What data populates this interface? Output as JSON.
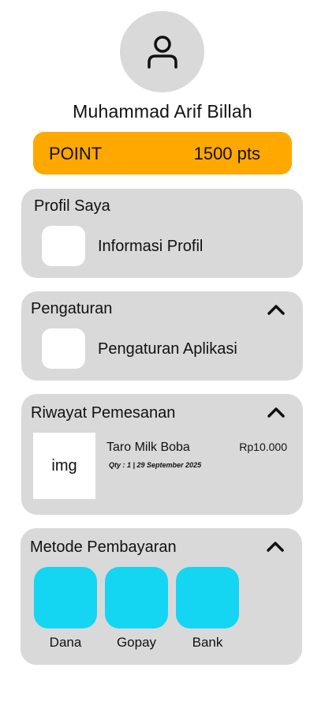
{
  "profile": {
    "name": "Muhammad Arif Billah",
    "avatar_icon": "user-icon"
  },
  "points": {
    "label": "POINT",
    "value": "1500 pts",
    "color": "#ffa800"
  },
  "sections": {
    "profil": {
      "title": "Profil Saya",
      "item": "Informasi Profil"
    },
    "pengaturan": {
      "title": "Pengaturan",
      "item": "Pengaturan Aplikasi",
      "toggle_icon": "chevron-up-icon"
    },
    "riwayat": {
      "title": "Riwayat Pemesanan",
      "toggle_icon": "chevron-up-icon",
      "order": {
        "image_text": "img",
        "name": "Taro Milk Boba",
        "price": "Rp10.000",
        "meta": "Qty : 1 | 29 September 2025"
      }
    },
    "pembayaran": {
      "title": "Metode Pembayaran",
      "toggle_icon": "chevron-up-icon",
      "tile_color": "#15d6f2",
      "methods": [
        "Dana",
        "Gopay",
        "Bank"
      ]
    }
  }
}
